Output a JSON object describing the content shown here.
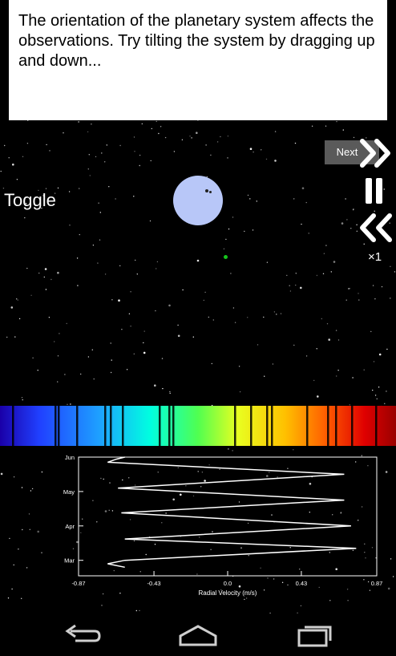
{
  "instruction": {
    "text": "The orientation of the planetary system affects the observations. Try tilting the system by dragging up and down..."
  },
  "controls": {
    "toggle_label": "Toggle",
    "next_label": "Next",
    "speed_label": "×1"
  },
  "icons": {
    "next": "double-chevron-right-icon",
    "pause": "pause-icon",
    "rewind": "double-chevron-left-icon",
    "back": "back-icon",
    "home": "home-icon",
    "recents": "recent-apps-icon"
  },
  "colors": {
    "planet": "#b8c7f8",
    "star": "#16c51c",
    "next_button_bg": "#5a5a5a",
    "instruction_bg": "#ffffff"
  },
  "chart_data": {
    "type": "line",
    "xlabel": "Radial Velocity (m/s)",
    "ylabel": "",
    "x_ticks": [
      "-0.87",
      "-0.43",
      "0.0",
      "0.43",
      "0.87"
    ],
    "y_ticks": [
      "Jun",
      "May",
      "Apr",
      "Mar"
    ],
    "xlim": [
      -0.87,
      0.87
    ],
    "ylim_months": [
      2.55,
      6.0
    ],
    "grid": false,
    "series": [
      {
        "x": [
          -0.6,
          -0.7,
          -0.6,
          0.75,
          -0.6,
          0.72,
          -0.62,
          0.68,
          -0.64,
          0.68,
          -0.7,
          -0.65,
          -0.6
        ],
        "month": [
          2.8,
          2.9,
          3.0,
          3.35,
          3.62,
          4.0,
          4.38,
          4.75,
          5.1,
          5.5,
          5.85,
          5.94,
          6.0
        ]
      }
    ]
  }
}
